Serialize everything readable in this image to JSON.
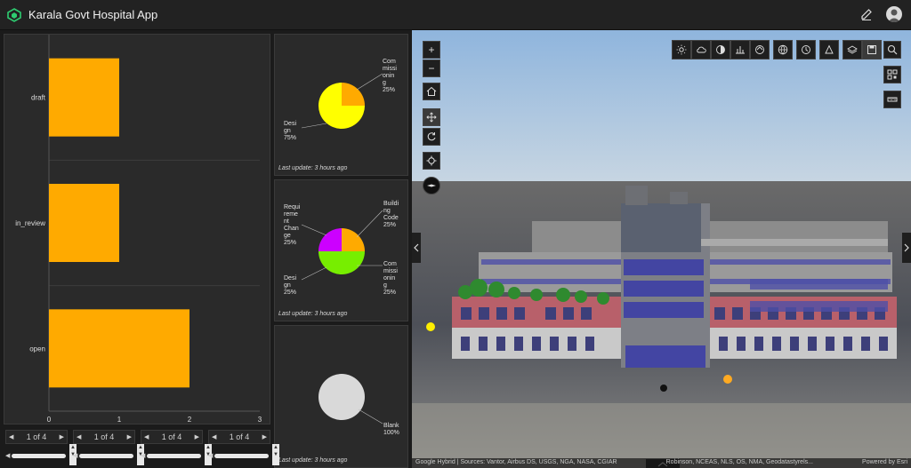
{
  "header": {
    "title": "Karala Govt Hospital App",
    "edit_icon": "pencil-icon",
    "avatar_icon": "user-avatar-icon"
  },
  "colors": {
    "accent": "#ffaa00",
    "pie_design": "#ffff00",
    "pie_purple": "#cc00ff",
    "pie_green": "#77ee00",
    "pie_gray": "#d9d9d9"
  },
  "chart_data": [
    {
      "type": "bar",
      "orientation": "horizontal",
      "categories": [
        "draft",
        "in_review",
        "open"
      ],
      "values": [
        1,
        1,
        2
      ],
      "xlim": [
        0,
        3
      ],
      "xticks": [
        "0",
        "1",
        "2",
        "3"
      ],
      "color": "#ffaa00"
    },
    {
      "type": "pie",
      "labels": [
        "Commissioning",
        "Design"
      ],
      "label_lines": [
        [
          "Com",
          "missi",
          "onin",
          "g",
          "25%"
        ],
        [
          "Desi",
          "gn",
          "75%"
        ]
      ],
      "values": [
        25,
        75
      ],
      "colors": [
        "#ffaa00",
        "#ffff00"
      ]
    },
    {
      "type": "pie",
      "labels": [
        "Building Code",
        "Commissioning",
        "Design",
        "Requirement Change"
      ],
      "label_lines": [
        [
          "Buildi",
          "ng",
          "Code",
          "25%"
        ],
        [
          "Com",
          "missi",
          "onin",
          "g",
          "25%"
        ],
        [
          "Desi",
          "gn",
          "25%"
        ],
        [
          "Requi",
          "reme",
          "nt",
          "Chan",
          "ge",
          "25%"
        ]
      ],
      "values": [
        25,
        25,
        25,
        25
      ],
      "colors": [
        "#ffaa00",
        "#77ee00",
        "#77ee00",
        "#cc00ff"
      ]
    },
    {
      "type": "pie",
      "labels": [
        "Blank"
      ],
      "label_lines": [
        [
          "Blank",
          "100%"
        ]
      ],
      "values": [
        100
      ],
      "colors": [
        "#d9d9d9"
      ]
    }
  ],
  "pie_panels": {
    "last_update": "Last update: 3 hours ago"
  },
  "pagers": [
    {
      "text": "1 of 4"
    },
    {
      "text": "1 of 4"
    },
    {
      "text": "1 of 4"
    },
    {
      "text": "1 of 4"
    }
  ],
  "map": {
    "zoom_in": "+",
    "zoom_out": "−",
    "toolbar_icons": [
      "daylight-icon",
      "weather-icon",
      "shadow-icon",
      "elevation-icon",
      "measure-icon",
      "basemap-icon",
      "time-icon",
      "slice-icon",
      "layers-icon",
      "save-icon"
    ],
    "right_icons": [
      "search-icon",
      "qr-icon",
      "measure-line-icon"
    ],
    "attribution_left": "Google Hybrid | Sources: Vantor, Airbus DS, USGS, NGA, NASA, CGIAR",
    "attribution_mid": "Robinson, NCEAS, NLS, OS, NMA, Geodatastyrels...",
    "attribution_right": "Powered by Esri"
  }
}
